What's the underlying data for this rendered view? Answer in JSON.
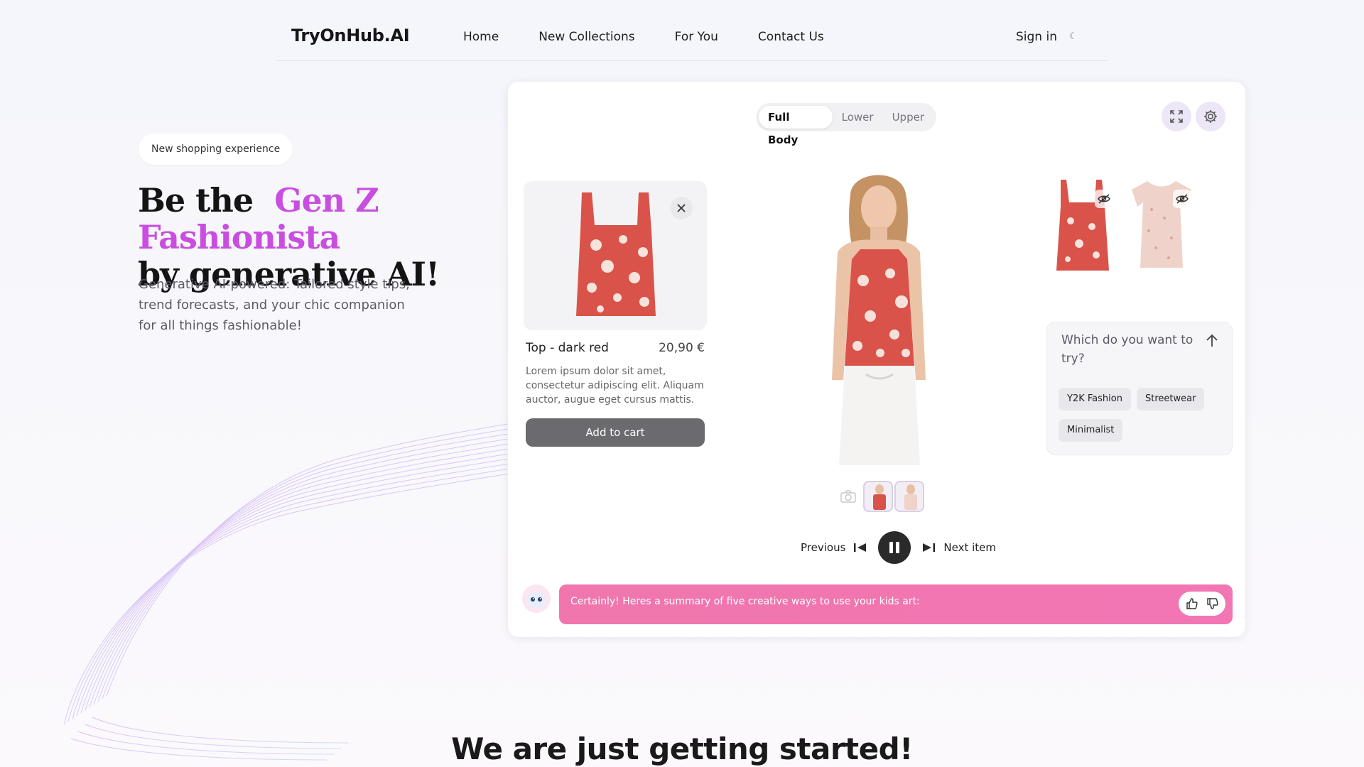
{
  "header": {
    "brand": "TryOnHub.AI",
    "nav": [
      "Home",
      "New Collections",
      "For You",
      "Contact Us"
    ],
    "signin": "Sign in",
    "theme_icon": "moon-icon"
  },
  "hero": {
    "pill": "New shopping experience",
    "title_lead": "Be the",
    "title_accent": "Gen Z Fashionista",
    "title_tail": "by generative AI!",
    "subtitle": "Generative AI-powered: Tailored style tips, trend forecasts, and your chic companion for all things fashionable!"
  },
  "tryon": {
    "segments": [
      "Full Body",
      "Lower",
      "Upper"
    ],
    "active_segment": "Full Body",
    "product": {
      "name": "Top - dark red",
      "price": "20,90 €",
      "description": "Lorem ipsum dolor sit amet, consectetur adipiscing elit. Aliquam auctor, augue eget cursus mattis.",
      "add_to_cart": "Add to cart"
    },
    "controls": {
      "previous": "Previous",
      "next": "Next item"
    },
    "ask": {
      "prompt": "Which do you want to try?",
      "chips": [
        "Y2K Fashion",
        "Streetwear",
        "Minimalist"
      ]
    },
    "chat": {
      "message": "Certainly! Heres a summary of five creative ways to use your kids art:"
    }
  },
  "colors": {
    "accent": "#c94ee0",
    "chat_bg": "#f076ad",
    "garment_red": "#d9534a",
    "button_gray": "#6b6b6f"
  },
  "section": {
    "title": "We are just getting started!"
  }
}
